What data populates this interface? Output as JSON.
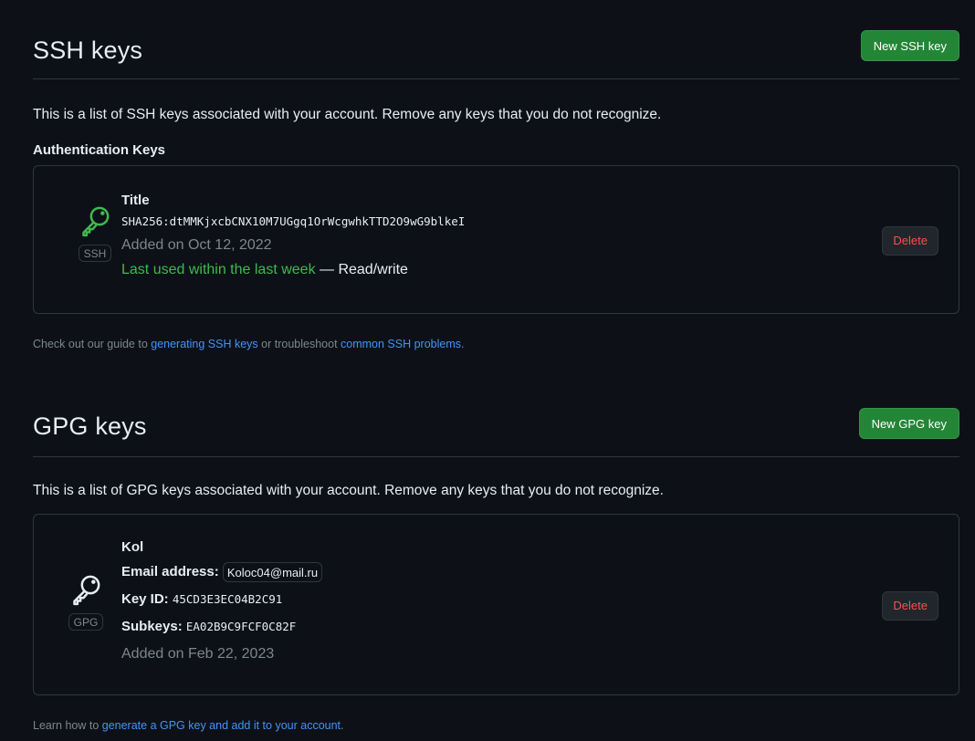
{
  "ssh": {
    "title": "SSH keys",
    "new_button": "New SSH key",
    "description": "This is a list of SSH keys associated with your account. Remove any keys that you do not recognize.",
    "subheading": "Authentication Keys",
    "key": {
      "type_label": "SSH",
      "title": "Title",
      "fingerprint": "SHA256:dtMMKjxcbCNX10M7UGgq1OrWcgwhkTTD2O9wG9blkeI",
      "added": "Added on Oct 12, 2022",
      "last_used": "Last used within the last week",
      "access": " — Read/write",
      "delete_label": "Delete"
    },
    "footer": {
      "prefix": "Check out our guide to ",
      "link1": "generating SSH keys",
      "middle": " or troubleshoot ",
      "link2": "common SSH problems",
      "suffix": "."
    }
  },
  "gpg": {
    "title": "GPG keys",
    "new_button": "New GPG key",
    "description": "This is a list of GPG keys associated with your account. Remove any keys that you do not recognize.",
    "key": {
      "type_label": "GPG",
      "name": "Kol",
      "email_label": "Email address:",
      "email": "Koloc04@mail.ru",
      "keyid_label": "Key ID:",
      "keyid": "45CD3E3EC04B2C91",
      "subkeys_label": "Subkeys:",
      "subkeys": "EA02B9C9FCF0C82F",
      "added": "Added on Feb 22, 2023",
      "delete_label": "Delete"
    },
    "footer": {
      "prefix": "Learn how to ",
      "link": "generate a GPG key and add it to your account",
      "suffix": "."
    }
  },
  "colors": {
    "background": "#0d1117",
    "border": "#30363d",
    "primary_button": "#238636",
    "danger_text": "#f85149",
    "success_text": "#3fb950",
    "link": "#4493f8",
    "muted": "#7d8590",
    "ssh_icon": "#3fb950",
    "gpg_icon": "#e6edf3"
  },
  "icons": {
    "ssh_key": "key-icon",
    "gpg_key": "key-icon"
  }
}
